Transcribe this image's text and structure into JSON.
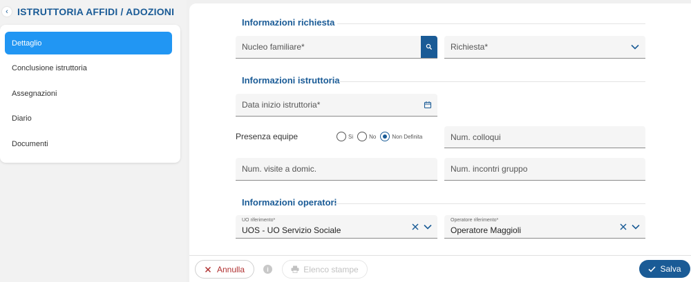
{
  "sidebar": {
    "title": "ISTRUTTORIA AFFIDI / ADOZIONI",
    "back_icon": "chevron-left-icon",
    "items": [
      {
        "label": "Dettaglio",
        "active": true
      },
      {
        "label": "Conclusione istruttoria",
        "active": false
      },
      {
        "label": "Assegnazioni",
        "active": false
      },
      {
        "label": "Diario",
        "active": false
      },
      {
        "label": "Documenti",
        "active": false
      }
    ]
  },
  "sections": {
    "richiesta": {
      "title": "Informazioni richiesta",
      "nucleo_placeholder": "Nucleo familiare*",
      "richiesta_placeholder": "Richiesta*"
    },
    "istruttoria": {
      "title": "Informazioni istruttoria",
      "data_inizio_placeholder": "Data inizio istruttoria*",
      "presenza_label": "Presenza equipe",
      "radio_options": [
        {
          "label": "Si",
          "checked": false
        },
        {
          "label": "No",
          "checked": false
        },
        {
          "label": "Non Definita",
          "checked": true
        }
      ],
      "colloqui_placeholder": "Num. colloqui",
      "visite_placeholder": "Num. visite a domic.",
      "incontri_placeholder": "Num. incontri gruppo"
    },
    "operatori": {
      "title": "Informazioni operatori",
      "uo_label": "UO riferimento*",
      "uo_value": "UOS - UO Servizio Sociale",
      "operatore_label": "Operatore riferimento*",
      "operatore_value": "Operatore Maggioli"
    }
  },
  "footer": {
    "annulla_label": "Annulla",
    "elenco_label": "Elenco stampe",
    "salva_label": "Salva"
  },
  "colors": {
    "primary": "#1a5b96",
    "active_nav": "#2196f3",
    "danger": "#b03030"
  }
}
